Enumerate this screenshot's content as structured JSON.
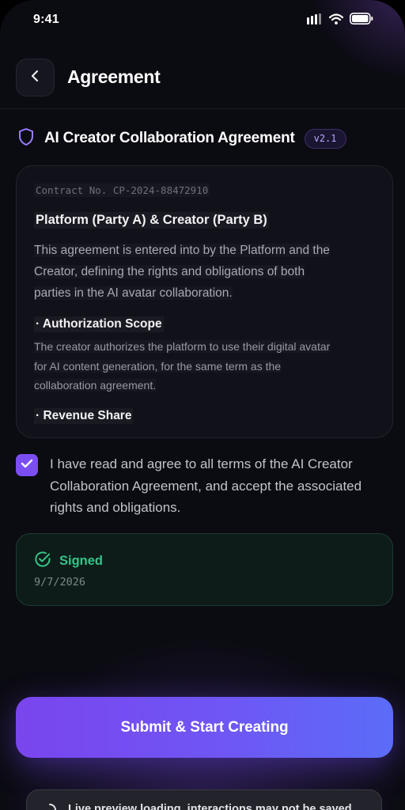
{
  "status_bar": {
    "time": "9:41",
    "icons": [
      "cellular-signal-icon",
      "wifi-icon",
      "battery-icon"
    ]
  },
  "header": {
    "back_icon": "chevron-left-icon",
    "title": "Agreement"
  },
  "agreement": {
    "icon": "shield-icon",
    "title": "AI Creator Collaboration Agreement",
    "version": "v2.1"
  },
  "contract": {
    "number": "Contract No. CP-2024-88472910",
    "parties": "Platform (Party A) & Creator (Party B)",
    "intro_lines": [
      "This agreement is entered into by the Platform and the",
      "Creator, defining the rights and obligations of both",
      "parties in the AI avatar collaboration."
    ],
    "clauses": [
      {
        "heading": "· Authorization Scope",
        "body_lines": [
          "The creator authorizes the platform to use their digital avatar",
          "for AI content generation, for the same term as the",
          "collaboration agreement."
        ]
      },
      {
        "heading": "· Revenue Share",
        "body_lines": []
      }
    ]
  },
  "consent": {
    "checked": true,
    "text": "I have read and agree to all terms of the AI Creator Collaboration Agreement, and accept the associated rights and obligations."
  },
  "signature": {
    "status": "Signed",
    "date": "9/7/2026"
  },
  "submit": {
    "label": "Submit & Start Creating"
  },
  "toast": {
    "text": "Live preview loading, interactions may not be saved"
  },
  "colors": {
    "background": "#0b0b12",
    "accent": "#7b4df2",
    "success": "#34c489",
    "badge_text": "#b9a6ff"
  }
}
